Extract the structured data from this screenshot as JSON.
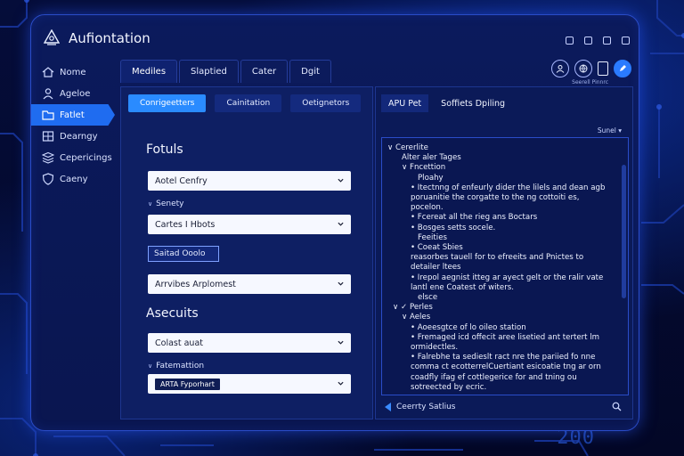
{
  "app": {
    "title": "Aufiontation"
  },
  "sidebar": {
    "items": [
      {
        "label": "Nome",
        "icon": "house-icon"
      },
      {
        "label": "Ageloe",
        "icon": "person-icon"
      },
      {
        "label": "Fatlet",
        "icon": "folder-icon",
        "active": true
      },
      {
        "label": "Dearngy",
        "icon": "grid-icon"
      },
      {
        "label": "Cepericings",
        "icon": "layers-icon"
      },
      {
        "label": "Caeny",
        "icon": "shield-icon"
      }
    ]
  },
  "main_tabs": [
    {
      "label": "Mediles",
      "active": true
    },
    {
      "label": "Slaptied"
    },
    {
      "label": "Cater"
    },
    {
      "label": "Dgit"
    }
  ],
  "top_right": {
    "caption": "Seerell Pinnrc"
  },
  "left_panel": {
    "sub_tabs": [
      {
        "label": "Conrigeetters",
        "active": true
      },
      {
        "label": "Cainitation"
      },
      {
        "label": "Oetignetors"
      }
    ],
    "section1_title": "Fotuls",
    "select1": "Aotel Cenfry",
    "label2": "Senety",
    "select2": "Cartes I Hbots",
    "badge_button": "Saitad Ooolo",
    "select3": "Arrvibes Arplomest",
    "section2_title": "Asecuits",
    "select4": "Colast auat",
    "label5": "Fatemattion",
    "select5_chip": "ARTA Fyporhart"
  },
  "right_panel": {
    "tabs": [
      {
        "label": "APU Pet",
        "active": true
      },
      {
        "label": "Soffiets Dpiling"
      }
    ],
    "sort_label": "Sunel",
    "tree": [
      {
        "text": "∨  Cererlite",
        "indent": 0
      },
      {
        "text": "Alter aler Tages",
        "indent": 16
      },
      {
        "text": "∨  Fncettion",
        "indent": 16
      },
      {
        "text": "Ploahy",
        "indent": 34
      },
      {
        "text": "•  Itectnng of enfeurly dider the lilels and dean agb",
        "indent": 26
      },
      {
        "text": "poruanitie the corgatte to the ng cottoiti es,",
        "indent": 26
      },
      {
        "text": "pocelon.",
        "indent": 26
      },
      {
        "text": "•  Fcereat all the rieg ans Boctars",
        "indent": 26
      },
      {
        "text": "•  Bosges setts socele.",
        "indent": 26
      },
      {
        "text": "Feeities",
        "indent": 34
      },
      {
        "text": "•  Coeat Sbies",
        "indent": 26
      },
      {
        "text": "reasorbes tauell for to efreeits and Pnictes to",
        "indent": 26
      },
      {
        "text": "detailer ltees",
        "indent": 26
      },
      {
        "text": "•  Irepol aegnist itteg ar ayect gelt or the ralir vate",
        "indent": 26
      },
      {
        "text": "lantl ene Coatest of witers.",
        "indent": 26
      },
      {
        "text": "elsce",
        "indent": 34
      },
      {
        "text": "∨ ✓ Perles",
        "indent": 6
      },
      {
        "text": "∨  Aeles",
        "indent": 16
      },
      {
        "text": "•  Aoeesgtce of lo oileo station",
        "indent": 26
      },
      {
        "text": "•  Fremaged icd offecit aree lisetied ant tertert lm",
        "indent": 26
      },
      {
        "text": "ormidectles.",
        "indent": 26
      },
      {
        "text": "•  Falrebhe ta sedieslt ract nre the pariied fo nne",
        "indent": 26
      },
      {
        "text": "comma ct ecotterrelCuertiant esicoatie tng ar orn",
        "indent": 26
      },
      {
        "text": "coadfly ifag ef cottlegerice for and tning ou",
        "indent": 26
      },
      {
        "text": "sotreected by ecric.",
        "indent": 26
      }
    ],
    "footer_label": "Ceerrty Satlius"
  },
  "decor": {
    "corner_number": "200"
  },
  "colors": {
    "accent": "#2a8bff",
    "active_side": "#1f6cf0",
    "panel": "#0e1f63"
  }
}
